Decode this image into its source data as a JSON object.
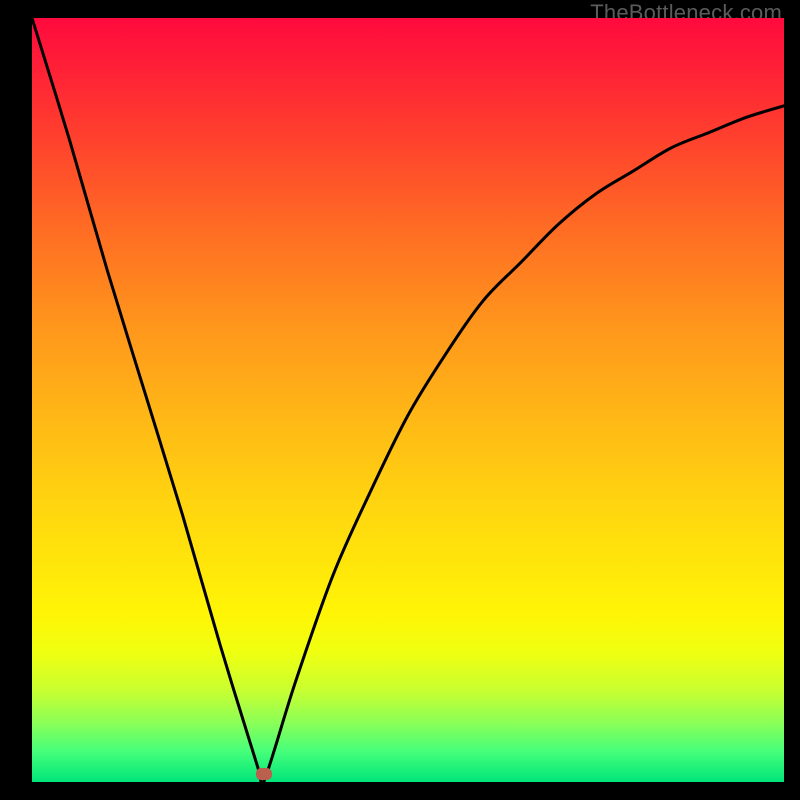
{
  "watermark": "TheBottleneck.com",
  "colors": {
    "background": "#000000",
    "curve": "#000000",
    "marker": "#b9604f"
  },
  "chart_data": {
    "type": "line",
    "title": "",
    "xlabel": "",
    "ylabel": "",
    "x": [
      0,
      0.05,
      0.1,
      0.15,
      0.2,
      0.25,
      0.3,
      0.308,
      0.35,
      0.4,
      0.45,
      0.5,
      0.55,
      0.6,
      0.65,
      0.7,
      0.75,
      0.8,
      0.85,
      0.9,
      0.95,
      1.0
    ],
    "values": [
      1.0,
      0.84,
      0.67,
      0.51,
      0.35,
      0.18,
      0.02,
      0.0,
      0.13,
      0.27,
      0.38,
      0.48,
      0.56,
      0.63,
      0.68,
      0.73,
      0.77,
      0.8,
      0.83,
      0.85,
      0.87,
      0.885
    ],
    "xlim": [
      0,
      1
    ],
    "ylim": [
      0,
      1
    ],
    "marker": {
      "x": 0.308,
      "y": 0.01
    },
    "background_gradient": "mismatch-heatmap (red=high top, green=low bottom)"
  }
}
